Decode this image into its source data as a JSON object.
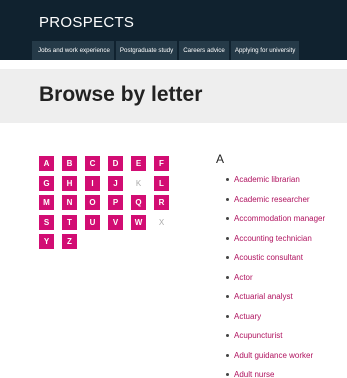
{
  "header": {
    "logo": "PROSPECTS",
    "nav": [
      "Jobs and work experience",
      "Postgraduate study",
      "Careers advice",
      "Applying for university"
    ]
  },
  "page_title": "Browse by letter",
  "letters": [
    {
      "label": "A",
      "enabled": true
    },
    {
      "label": "B",
      "enabled": true
    },
    {
      "label": "C",
      "enabled": true
    },
    {
      "label": "D",
      "enabled": true
    },
    {
      "label": "E",
      "enabled": true
    },
    {
      "label": "F",
      "enabled": true
    },
    {
      "label": "G",
      "enabled": true
    },
    {
      "label": "H",
      "enabled": true
    },
    {
      "label": "I",
      "enabled": true
    },
    {
      "label": "J",
      "enabled": true
    },
    {
      "label": "K",
      "enabled": false
    },
    {
      "label": "L",
      "enabled": true
    },
    {
      "label": "M",
      "enabled": true
    },
    {
      "label": "N",
      "enabled": true
    },
    {
      "label": "O",
      "enabled": true
    },
    {
      "label": "P",
      "enabled": true
    },
    {
      "label": "Q",
      "enabled": true
    },
    {
      "label": "R",
      "enabled": true
    },
    {
      "label": "S",
      "enabled": true
    },
    {
      "label": "T",
      "enabled": true
    },
    {
      "label": "U",
      "enabled": true
    },
    {
      "label": "V",
      "enabled": true
    },
    {
      "label": "W",
      "enabled": true
    },
    {
      "label": "X",
      "enabled": false
    },
    {
      "label": "Y",
      "enabled": true
    },
    {
      "label": "Z",
      "enabled": true
    }
  ],
  "section_heading": "A",
  "careers": [
    "Academic librarian",
    "Academic researcher",
    "Accommodation manager",
    "Accounting technician",
    "Acoustic consultant",
    "Actor",
    "Actuarial analyst",
    "Actuary",
    "Acupuncturist",
    "Adult guidance worker",
    "Adult nurse"
  ],
  "colors": {
    "header_bg": "#10222f",
    "accent": "#d20d73",
    "link": "#b0125f"
  }
}
